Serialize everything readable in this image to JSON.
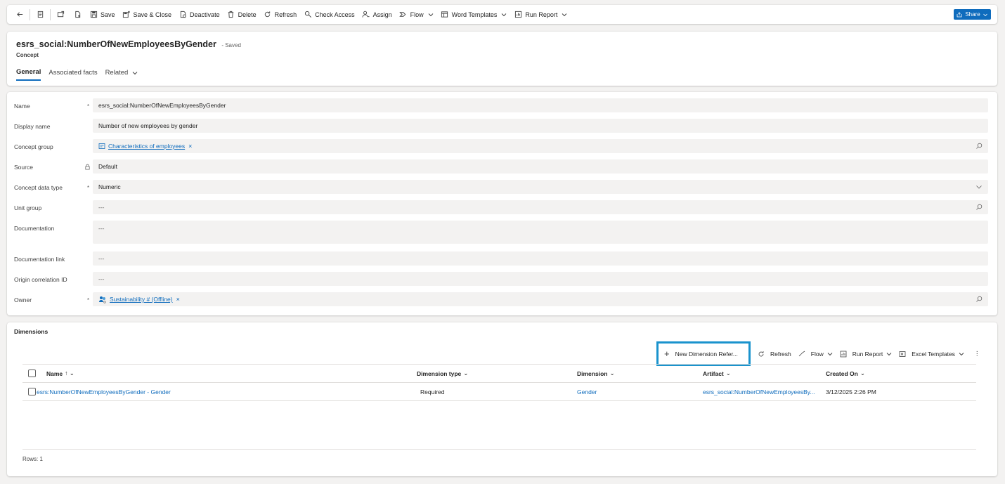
{
  "commandbar": {
    "save": "Save",
    "save_close": "Save & Close",
    "deactivate": "Deactivate",
    "delete": "Delete",
    "refresh": "Refresh",
    "check_access": "Check Access",
    "assign": "Assign",
    "flow": "Flow",
    "word_templates": "Word Templates",
    "run_report": "Run Report",
    "share": "Share"
  },
  "header": {
    "title": "esrs_social:NumberOfNewEmployeesByGender",
    "saved_status": "- Saved",
    "entity": "Concept",
    "tabs": [
      {
        "label": "General"
      },
      {
        "label": "Associated facts"
      },
      {
        "label": "Related"
      }
    ]
  },
  "form": {
    "name": {
      "label": "Name",
      "required": "*",
      "value": "esrs_social:NumberOfNewEmployeesByGender"
    },
    "display_name": {
      "label": "Display name",
      "value": "Number of new employees by gender"
    },
    "concept_group": {
      "label": "Concept group",
      "value": "Characteristics of employees",
      "remove": "×"
    },
    "source": {
      "label": "Source",
      "value": "Default"
    },
    "concept_data_type": {
      "label": "Concept data type",
      "required": "*",
      "value": "Numeric"
    },
    "unit_group": {
      "label": "Unit group",
      "value": "---"
    },
    "documentation": {
      "label": "Documentation",
      "value": "---"
    },
    "documentation_link": {
      "label": "Documentation link",
      "value": "---"
    },
    "origin_correlation_id": {
      "label": "Origin correlation ID",
      "value": "---"
    },
    "owner": {
      "label": "Owner",
      "required": "*",
      "value": "Sustainability # (Offline)",
      "remove": "×"
    }
  },
  "dimensions": {
    "title": "Dimensions",
    "toolbar": {
      "plus": "+",
      "new_dimension": "New Dimension Refer...",
      "refresh": "Refresh",
      "flow": "Flow",
      "run_report": "Run Report",
      "excel_templates": "Excel Templates",
      "more": "⋮"
    },
    "columns": [
      {
        "label": "Name",
        "sort": "↑ ⌄"
      },
      {
        "label": "Dimension type",
        "sort": "⌄"
      },
      {
        "label": "Dimension",
        "sort": "⌄"
      },
      {
        "label": "Artifact",
        "sort": "⌄"
      },
      {
        "label": "Created On",
        "sort": "⌄"
      }
    ],
    "rows": [
      {
        "name": "esrs:NumberOfNewEmployeesByGender - Gender",
        "dimension_type": "Required",
        "dimension": "Gender",
        "artifact": "esrs_social:NumberOfNewEmployeesBy...",
        "created_on": "3/12/2025 2:26 PM"
      }
    ],
    "rows_count": "Rows: 1"
  },
  "colors": {
    "accent": "#0f6cbd",
    "highlight": "#1a93cd",
    "background": "#f3f2f1"
  }
}
